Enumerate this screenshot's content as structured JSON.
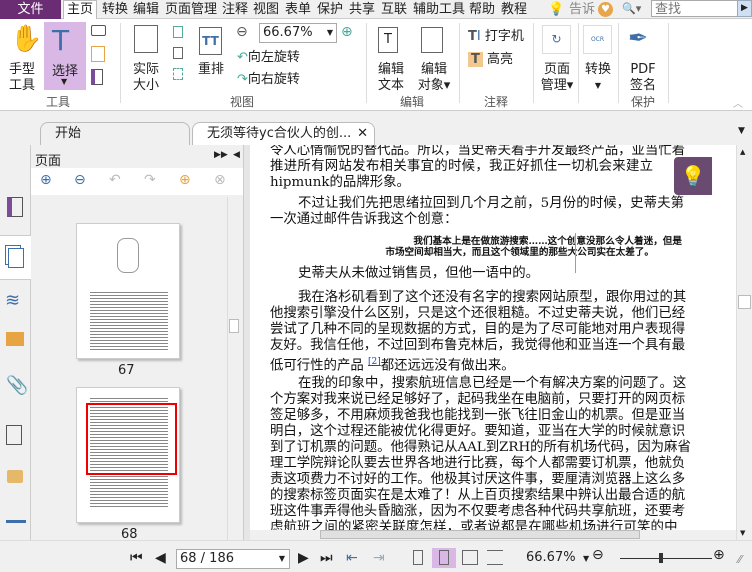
{
  "menu": {
    "file": "文件",
    "items": [
      "主页",
      "转换",
      "编辑",
      "页面管理",
      "注释",
      "视图",
      "表单",
      "保护",
      "共享",
      "互联",
      "辅助工具",
      "帮助",
      "教程"
    ],
    "tell": "告诉",
    "search_placeholder": "查找"
  },
  "ribbon": {
    "hand": [
      "手型",
      "工具"
    ],
    "select": "选择",
    "group_tools": "工具",
    "actual": [
      "实际",
      "大小"
    ],
    "zoom": "66.67%",
    "rotate_left": "向左旋转",
    "rotate_right": "向右旋转",
    "reflow": "重排",
    "group_view": "视图",
    "edit_text": [
      "编辑",
      "文本"
    ],
    "edit_object": [
      "编辑",
      "对象"
    ],
    "group_edit": "编辑",
    "typewriter": "打字机",
    "highlight": "高亮",
    "group_comment": "注释",
    "page_mgmt": [
      "页面",
      "管理"
    ],
    "convert": "转换",
    "pdf_sign": [
      "PDF",
      "签名"
    ],
    "group_protect": "保护"
  },
  "tabs": [
    {
      "label": "开始"
    },
    {
      "label": "无须等待yc合伙人的创..."
    }
  ],
  "panel": {
    "title": "页面",
    "thumbs": [
      {
        "label": "67"
      },
      {
        "label": "68"
      }
    ]
  },
  "document": {
    "lines": [
      "令人心情愉悦的替代品。所以，当史蒂夫着手开发最终产品，亚当忙着",
      "推进所有网站发布相关事宜的时候，我正好抓住一切机会来建立",
      "hipmunk的品牌形象。",
      "不过让我们先把思绪拉回到几个月之前，5月份的时候，史蒂夫第",
      "一次通过邮件告诉我这个创意：",
      "我们基本上是在做旅游搜索……这个创意没那么令人着迷，但是",
      "市场空间却相当大，而且这个领域里的那些大公司实在太差了。",
      "史蒂夫从未做过销售员，但他一语中的。",
      "我在洛杉矶看到了这个还没有名字的搜索网站原型，跟你用过的其",
      "他搜索引擎没什么区别，只是这个还很粗糙。不过史蒂夫说，他们已经",
      "尝试了几种不同的呈现数据的方式，目的是为了尽可能地对用户表现得",
      "友好。我信任他，不过回到布鲁克林后，我觉得他和亚当连一个具有最",
      "低可行性的产品",
      "[2]",
      "都还远远没有做出来。",
      "在我的印象中，搜索航班信息已经是一个有解决方案的问题了。这",
      "个方案对我来说已经足够好了，起码我坐在电脑前，只要打开的网页标",
      "签足够多，不用麻烦我爸我也能找到一张飞往旧金山的机票。但是亚当",
      "明白，这个过程还能被优化得更好。要知道，亚当在大学的时候就意识",
      "到了订机票的问题。他得熟记从AAL到ZRH的所有机场代码，因为麻省",
      "理工学院辩论队要去世界各地进行比赛，每个人都需要订机票，他就负",
      "责这项费力不讨好的工作。他极其讨厌这件事，要厘清浏览器上这么多",
      "的搜索标签页面实在是太难了！从上百页搜索结果中辨认出最合适的航",
      "班这件事弄得他头昏脑涨，因为不仅要考虑各种代码共享航班，还要考",
      "虑航班之间的紧密关联度怎样，或者说都是在哪些机场进行可笑的中"
    ]
  },
  "status": {
    "page": "68 / 186",
    "zoom": "66.67%",
    "zoom_level": 0.45
  },
  "colors": {
    "accent": "#6a2c73",
    "select_bg": "#d9b8e6",
    "link": "#1a3fcc"
  }
}
